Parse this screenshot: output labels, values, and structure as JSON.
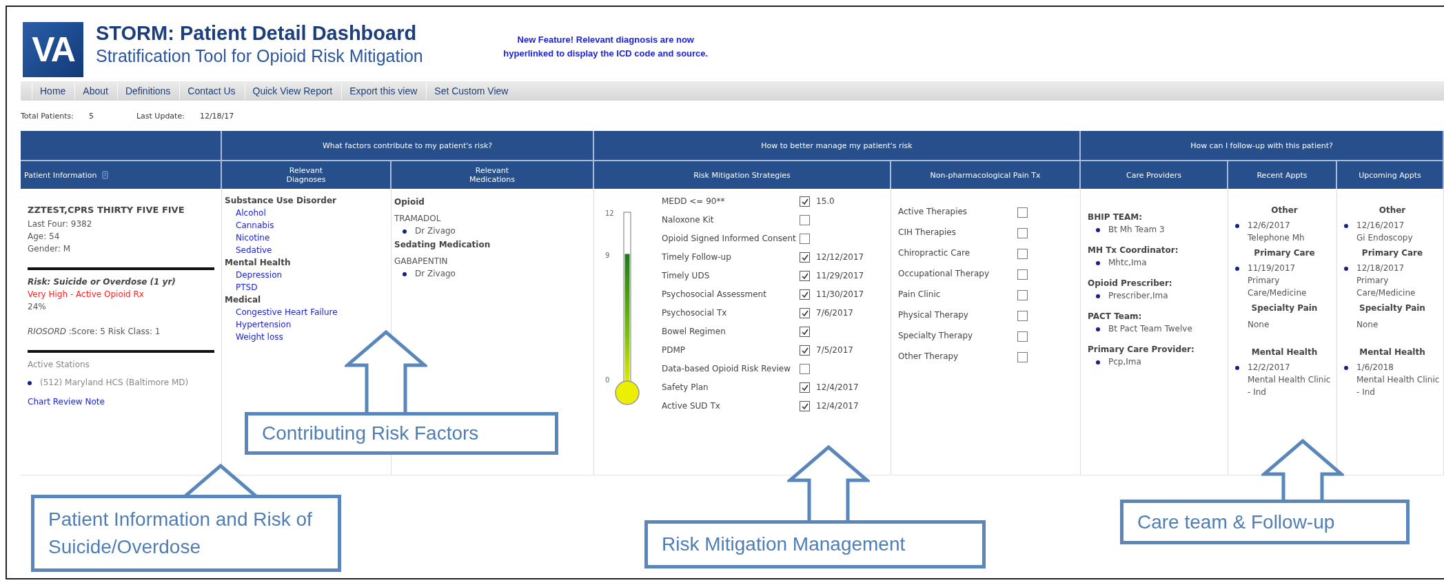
{
  "header": {
    "logo": "VA",
    "title": "STORM: Patient Detail Dashboard",
    "subtitle": "Stratification Tool for Opioid Risk Mitigation",
    "notice": "New Feature! Relevant diagnosis are now hyperlinked to display the ICD code and source."
  },
  "nav": [
    "Home",
    "About",
    "Definitions",
    "Contact Us",
    "Quick View Report",
    "Export this view",
    "Set Custom View"
  ],
  "summary": [
    {
      "label": "Total Patients:",
      "value": "5"
    },
    {
      "label": "Last Update:",
      "value": "12/18/17"
    }
  ],
  "group_headers": [
    "What factors contribute to my patient's risk?",
    "How to better manage my patient's risk",
    "How can I follow-up with this patient?"
  ],
  "columns": [
    "Patient Information",
    "Relevant Diagnoses",
    "Relevant Medications",
    "Risk Mitigation Strategies",
    "Non-pharmacological Pain Tx",
    "Care Providers",
    "Recent Appts",
    "Upcoming Appts"
  ],
  "patient": {
    "name": "ZZTEST,CPRS THIRTY FIVE FIVE",
    "details": [
      "Last Four: 9382",
      "Age: 54",
      "Gender: M"
    ],
    "risk_title": "Risk: Suicide or Overdose (1 yr)",
    "risk_level": "Very High - Active Opioid Rx",
    "risk_percent": "24%",
    "riosord": "*RIOSORD* :Score: 5 Risk Class: 1",
    "stations_label": "Active Stations",
    "stations": [
      "(512) Maryland HCS (Baltimore MD)"
    ],
    "link": "Chart Review Note"
  },
  "diagnoses": [
    {
      "name": "Substance Use Disorder",
      "items": [
        "Alcohol",
        "Cannabis",
        "Nicotine",
        "Sedative"
      ]
    },
    {
      "name": "Mental Health",
      "items": [
        "Depression",
        "PTSD"
      ]
    },
    {
      "name": "Medical",
      "items": [
        "Congestive Heart Failure",
        "Hypertension",
        "Weight loss"
      ]
    }
  ],
  "medications": [
    {
      "name": "Opioid",
      "drugs": [
        {
          "name": "TRAMADOL",
          "prescribers": [
            "Dr Zivago"
          ]
        }
      ]
    },
    {
      "name": "Sedating Medication",
      "drugs": [
        {
          "name": "GABAPENTIN",
          "prescribers": [
            "Dr Zivago"
          ]
        }
      ]
    }
  ],
  "thermometer": {
    "ticks": [
      "12",
      "9",
      "0"
    ],
    "level": 0.75
  },
  "strategies": [
    {
      "label": "MEDD <= 90**",
      "checked": true,
      "value": "15.0"
    },
    {
      "label": "Naloxone Kit",
      "checked": false
    },
    {
      "label": "Opioid Signed Informed Consent",
      "checked": false
    },
    {
      "label": "Timely Follow-up",
      "checked": true,
      "value": "12/12/2017"
    },
    {
      "label": "Timely UDS",
      "checked": true,
      "value": "11/29/2017"
    },
    {
      "label": "Psychosocial Assessment",
      "checked": true,
      "value": "11/30/2017"
    },
    {
      "label": "Psychosocial Tx",
      "checked": true,
      "value": "7/6/2017"
    },
    {
      "label": "Bowel Regimen",
      "checked": true
    },
    {
      "label": "PDMP",
      "checked": true,
      "value": "7/5/2017"
    },
    {
      "label": "Data-based Opioid Risk Review",
      "checked": false
    },
    {
      "label": "Safety Plan",
      "checked": true,
      "value": "12/4/2017"
    },
    {
      "label": "Active SUD Tx",
      "checked": true,
      "value": "12/4/2017"
    }
  ],
  "pain_tx": [
    {
      "label": "Active Therapies",
      "checked": false
    },
    {
      "label": "CIH Therapies",
      "checked": false
    },
    {
      "label": "Chiropractic Care",
      "checked": false
    },
    {
      "label": "Occupational Therapy",
      "checked": false
    },
    {
      "label": "Pain Clinic",
      "checked": false
    },
    {
      "label": "Physical Therapy",
      "checked": false
    },
    {
      "label": "Specialty Therapy",
      "checked": false
    },
    {
      "label": "Other Therapy",
      "checked": false
    }
  ],
  "care_providers": [
    {
      "role": "BHIP TEAM:",
      "names": [
        "Bt Mh Team 3"
      ]
    },
    {
      "role": "MH Tx Coordinator:",
      "names": [
        "Mhtc,Ima"
      ]
    },
    {
      "role": "Opioid Prescriber:",
      "names": [
        "Prescriber,Ima"
      ]
    },
    {
      "role": "PACT Team:",
      "names": [
        "Bt Pact Team Twelve"
      ]
    },
    {
      "role": "Primary Care Provider:",
      "names": [
        "Pcp,Ima"
      ]
    }
  ],
  "recent_appts": [
    {
      "category": "Other",
      "appts": [
        {
          "date": "12/6/2017",
          "clinic": "Telephone Mh"
        }
      ]
    },
    {
      "category": "Primary Care",
      "appts": [
        {
          "date": "11/19/2017",
          "clinic": "Primary Care/Medicine"
        }
      ]
    },
    {
      "category": "Specialty Pain",
      "note": "None"
    },
    {
      "category": "Mental Health",
      "appts": [
        {
          "date": "12/2/2017",
          "clinic": "Mental Health Clinic - Ind"
        }
      ]
    }
  ],
  "upcoming_appts": [
    {
      "category": "Other",
      "appts": [
        {
          "date": "12/16/2017",
          "clinic": "Gi Endoscopy"
        }
      ]
    },
    {
      "category": "Primary Care",
      "appts": [
        {
          "date": "12/18/2017",
          "clinic": "Primary Care/Medicine"
        }
      ]
    },
    {
      "category": "Specialty Pain",
      "note": "None"
    },
    {
      "category": "Mental Health",
      "appts": [
        {
          "date": "1/6/2018",
          "clinic": "Mental Health Clinic - Ind"
        }
      ]
    }
  ],
  "callouts": [
    "Patient Information and Risk of Suicide/Overdose",
    "Contributing Risk Factors",
    "Risk Mitigation Management",
    "Care team & Follow-up"
  ]
}
